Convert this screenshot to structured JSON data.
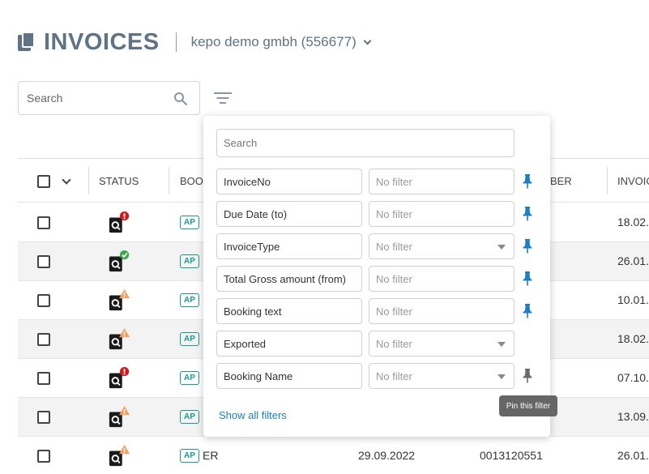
{
  "header": {
    "title": "INVOICES",
    "company": "kepo demo gmbh (556677)"
  },
  "search": {
    "placeholder": "Search"
  },
  "table": {
    "columns": [
      "STATUS",
      "BOO",
      "BER",
      "INVOIC"
    ],
    "rows": [
      {
        "status": "error",
        "badge": "AP",
        "date": "18.02."
      },
      {
        "status": "ok",
        "badge": "AP",
        "date": "26.01."
      },
      {
        "status": "warning",
        "badge": "AP",
        "date": "10.01."
      },
      {
        "status": "warning",
        "badge": "AP",
        "date": "18.02."
      },
      {
        "status": "error",
        "badge": "AP",
        "date": "07.10."
      },
      {
        "status": "warning",
        "badge": "AP",
        "date": "13.09."
      },
      {
        "status": "warning",
        "badge": "AP",
        "booking": "ER",
        "due": "29.09.2022",
        "number": "0013120551",
        "date": "26.01."
      }
    ]
  },
  "filter_panel": {
    "search_placeholder": "Search",
    "value_placeholder": "No filter",
    "filters": [
      {
        "label": "InvoiceNo",
        "dropdown": false,
        "pin": "pinned"
      },
      {
        "label": "Due Date (to)",
        "dropdown": false,
        "pin": "pinned"
      },
      {
        "label": "InvoiceType",
        "dropdown": true,
        "pin": "pinned"
      },
      {
        "label": "Total Gross amount (from)",
        "dropdown": false,
        "pin": "pinned"
      },
      {
        "label": "Booking text",
        "dropdown": false,
        "pin": "pinned"
      },
      {
        "label": "Exported",
        "dropdown": true,
        "pin": "none"
      },
      {
        "label": "Booking Name",
        "dropdown": true,
        "pin": "hover"
      }
    ],
    "show_all_label": "Show all filters",
    "tooltip": "Pin this filter"
  },
  "colors": {
    "title": "#5f7386",
    "accent": "#1a9a8a",
    "link": "#1a7fc4",
    "pin": "#1a7fc4",
    "error": "#d11a1a",
    "ok": "#3aa84a",
    "warning": "#f0a060"
  }
}
